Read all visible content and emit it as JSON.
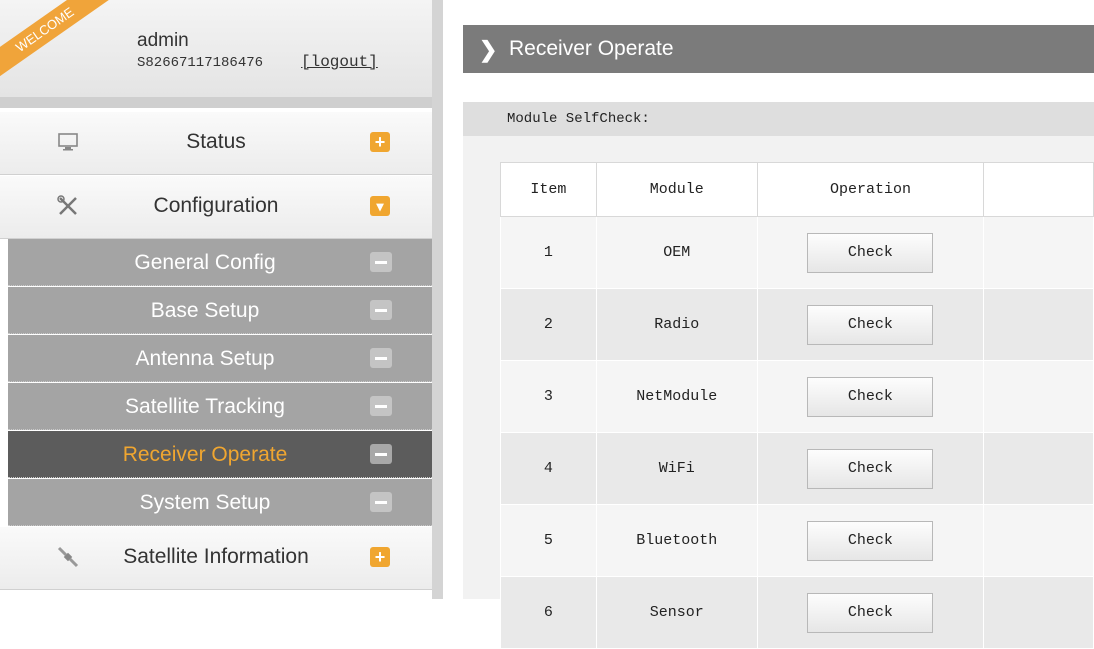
{
  "welcome": {
    "ribbon": "WELCOME",
    "user": "admin",
    "serial": "S82667117186476",
    "logout": "[logout]"
  },
  "menu": {
    "status": {
      "label": "Status",
      "toggle": "+"
    },
    "configuration": {
      "label": "Configuration",
      "toggle": "▾",
      "sub_items": [
        {
          "label": "General Config",
          "active": false
        },
        {
          "label": "Base Setup",
          "active": false
        },
        {
          "label": "Antenna Setup",
          "active": false
        },
        {
          "label": "Satellite Tracking",
          "active": false
        },
        {
          "label": "Receiver Operate",
          "active": true
        },
        {
          "label": "System Setup",
          "active": false
        }
      ]
    },
    "satellite_information": {
      "label": "Satellite Information",
      "toggle": "+"
    }
  },
  "main": {
    "title": "Receiver Operate",
    "section_title": "Module SelfCheck:",
    "table": {
      "headers": [
        "Item",
        "Module",
        "Operation",
        ""
      ],
      "rows": [
        {
          "item": "1",
          "module": "OEM",
          "button": "Check"
        },
        {
          "item": "2",
          "module": "Radio",
          "button": "Check"
        },
        {
          "item": "3",
          "module": "NetModule",
          "button": "Check"
        },
        {
          "item": "4",
          "module": "WiFi",
          "button": "Check"
        },
        {
          "item": "5",
          "module": "Bluetooth",
          "button": "Check"
        },
        {
          "item": "6",
          "module": "Sensor",
          "button": "Check"
        }
      ]
    }
  },
  "colors": {
    "accent": "#f0a630",
    "header": "#7b7b7b",
    "submenu": "#a4a4a4",
    "submenu_active": "#5c5c5c"
  },
  "icons": {
    "status": "monitor-icon",
    "configuration": "tools-icon",
    "satellite_information": "satellite-icon"
  }
}
